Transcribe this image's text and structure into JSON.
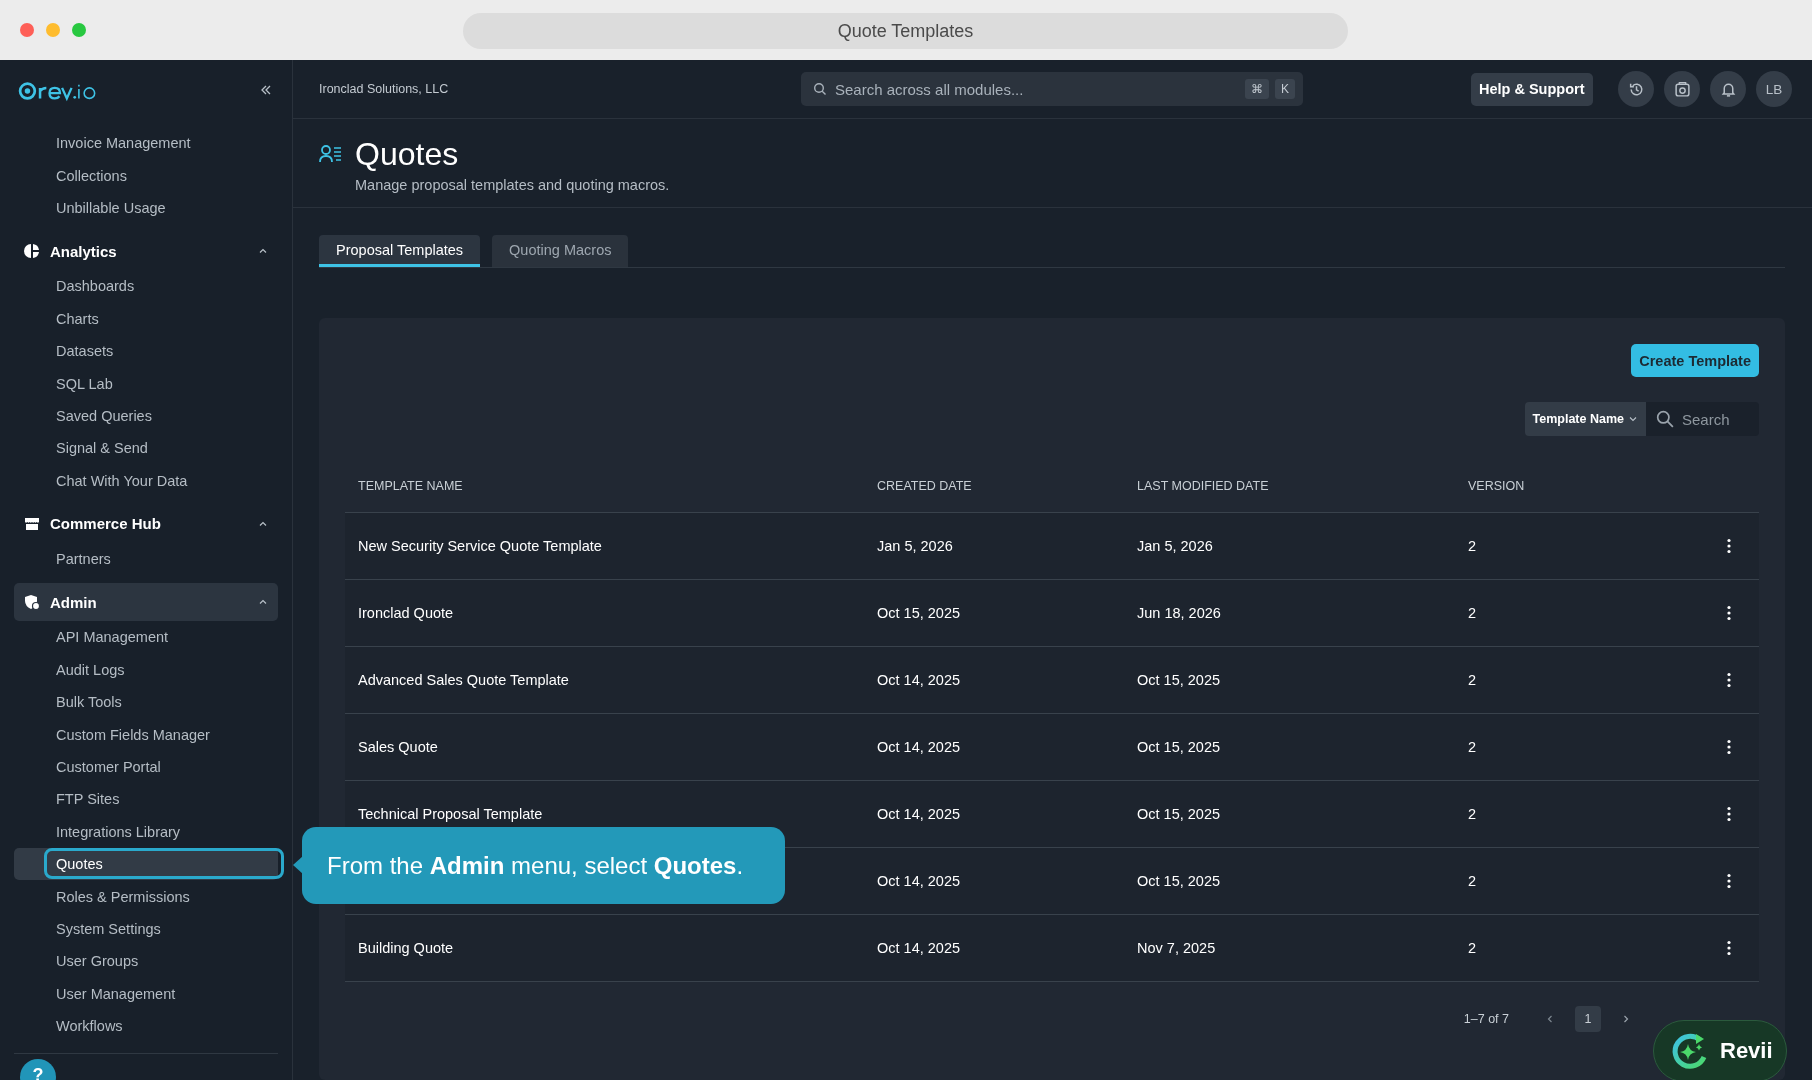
{
  "window": {
    "title": "Quote Templates"
  },
  "sidebar": {
    "groups": [
      {
        "items": [
          {
            "label": "Invoice Management",
            "selected": false
          },
          {
            "label": "Collections",
            "selected": false
          },
          {
            "label": "Unbillable Usage",
            "selected": false
          }
        ]
      },
      {
        "title": "Analytics",
        "expanded": true,
        "selected": false,
        "items": [
          {
            "label": "Dashboards",
            "selected": false
          },
          {
            "label": "Charts",
            "selected": false
          },
          {
            "label": "Datasets",
            "selected": false
          },
          {
            "label": "SQL Lab",
            "selected": false
          },
          {
            "label": "Saved Queries",
            "selected": false
          },
          {
            "label": "Signal & Send",
            "selected": false
          },
          {
            "label": "Chat With Your Data",
            "selected": false
          }
        ]
      },
      {
        "title": "Commerce Hub",
        "expanded": true,
        "selected": false,
        "items": [
          {
            "label": "Partners",
            "selected": false
          }
        ]
      },
      {
        "title": "Admin",
        "expanded": true,
        "selected": true,
        "items": [
          {
            "label": "API Management",
            "selected": false
          },
          {
            "label": "Audit Logs",
            "selected": false
          },
          {
            "label": "Bulk Tools",
            "selected": false
          },
          {
            "label": "Custom Fields Manager",
            "selected": false
          },
          {
            "label": "Customer Portal",
            "selected": false
          },
          {
            "label": "FTP Sites",
            "selected": false
          },
          {
            "label": "Integrations Library",
            "selected": false
          },
          {
            "label": "Quotes",
            "selected": true
          },
          {
            "label": "Roles & Permissions",
            "selected": false
          },
          {
            "label": "System Settings",
            "selected": false
          },
          {
            "label": "User Groups",
            "selected": false
          },
          {
            "label": "User Management",
            "selected": false
          },
          {
            "label": "Workflows",
            "selected": false
          }
        ]
      }
    ]
  },
  "topbar": {
    "company": "Ironclad Solutions, LLC",
    "search": {
      "placeholder": "Search across all modules...",
      "keys": [
        "⌘",
        "K"
      ]
    },
    "help_button": "Help & Support",
    "avatar": "LB"
  },
  "page": {
    "title": "Quotes",
    "subtitle": "Manage proposal templates and quoting macros."
  },
  "tabs": [
    {
      "label": "Proposal Templates",
      "selected": true
    },
    {
      "label": "Quoting Macros",
      "selected": false
    }
  ],
  "create_button": "Create Template",
  "filter": {
    "field": "Template Name",
    "placeholder": "Search"
  },
  "table": {
    "columns": [
      "TEMPLATE NAME",
      "CREATED DATE",
      "LAST MODIFIED DATE",
      "VERSION"
    ],
    "rows": [
      {
        "name": "New Security Service Quote Template",
        "created": "Jan 5, 2026",
        "modified": "Jan 5, 2026",
        "version": "2"
      },
      {
        "name": "Ironclad Quote",
        "created": "Oct 15, 2025",
        "modified": "Jun 18, 2026",
        "version": "2"
      },
      {
        "name": "Advanced Sales Quote Template",
        "created": "Oct 14, 2025",
        "modified": "Oct 15, 2025",
        "version": "2"
      },
      {
        "name": "Sales Quote",
        "created": "Oct 14, 2025",
        "modified": "Oct 15, 2025",
        "version": "2"
      },
      {
        "name": "Technical Proposal Template",
        "created": "Oct 14, 2025",
        "modified": "Oct 15, 2025",
        "version": "2"
      },
      {
        "created": "Oct 14, 2025",
        "modified": "Oct 15, 2025",
        "version": "2"
      },
      {
        "name": "Building Quote",
        "created": "Oct 14, 2025",
        "modified": "Nov 7, 2025",
        "version": "2"
      }
    ]
  },
  "pagination": {
    "range": "1–7 of 7",
    "pages": [
      {
        "label": "1",
        "selected": true
      }
    ]
  },
  "tooltip": "From the **Admin** menu, select **Quotes**.",
  "assistant_button": "Revii",
  "help_bubble": "?"
}
